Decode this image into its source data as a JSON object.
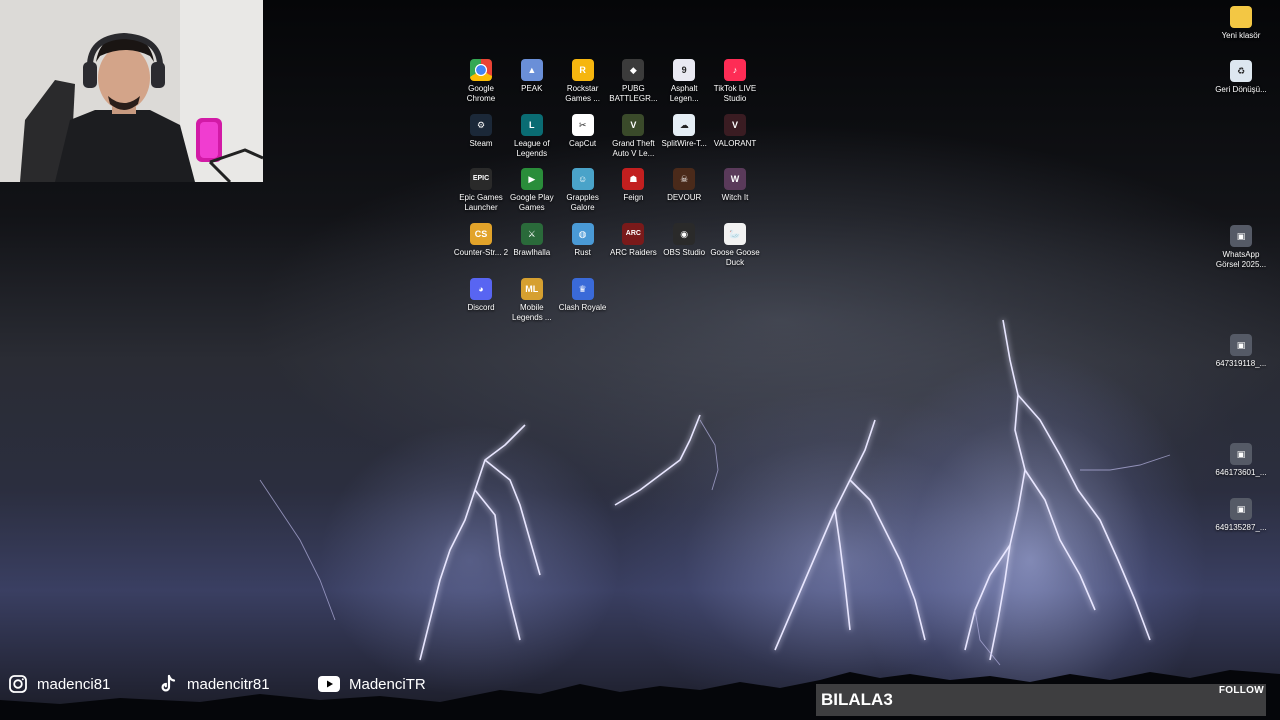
{
  "desktop_icons": [
    {
      "label": "Google Chrome",
      "icon": "chrome-icon"
    },
    {
      "label": "PEAK",
      "icon": "peak-icon"
    },
    {
      "label": "Rockstar Games ...",
      "icon": "rockstar-icon"
    },
    {
      "label": "PUBG BATTLEGR...",
      "icon": "pubg-icon"
    },
    {
      "label": "Asphalt Legen...",
      "icon": "asphalt-icon"
    },
    {
      "label": "TikTok LIVE Studio",
      "icon": "tiktok-live-icon"
    },
    {
      "label": "Steam",
      "icon": "steam-icon"
    },
    {
      "label": "League of Legends",
      "icon": "league-icon"
    },
    {
      "label": "CapCut",
      "icon": "capcut-icon"
    },
    {
      "label": "Grand Theft Auto V Le...",
      "icon": "gta-icon"
    },
    {
      "label": "SplitWire-T...",
      "icon": "splitwire-icon"
    },
    {
      "label": "VALORANT",
      "icon": "valorant-icon"
    },
    {
      "label": "Epic Games Launcher",
      "icon": "epic-icon"
    },
    {
      "label": "Google Play Games",
      "icon": "google-play-icon"
    },
    {
      "label": "Grapples Galore",
      "icon": "grapples-icon"
    },
    {
      "label": "Feign",
      "icon": "feign-icon"
    },
    {
      "label": "DEVOUR",
      "icon": "devour-icon"
    },
    {
      "label": "Witch It",
      "icon": "witch-it-icon"
    },
    {
      "label": "Counter-Str... 2",
      "icon": "counter-strike-icon"
    },
    {
      "label": "Brawlhalla",
      "icon": "brawlhalla-icon"
    },
    {
      "label": "Rust",
      "icon": "rust-icon"
    },
    {
      "label": "ARC Raiders",
      "icon": "arc-raiders-icon"
    },
    {
      "label": "OBS Studio",
      "icon": "obs-icon"
    },
    {
      "label": "Goose Goose Duck",
      "icon": "goose-icon"
    },
    {
      "label": "Discord",
      "icon": "discord-icon"
    },
    {
      "label": "Mobile Legends ...",
      "icon": "mobile-legends-icon"
    },
    {
      "label": "Clash Royale",
      "icon": "clash-royale-icon"
    }
  ],
  "right_icons": [
    {
      "label": "Yeni klasör",
      "icon": "folder-icon"
    },
    {
      "label": "Geri Dönüşü...",
      "icon": "recycle-bin-icon"
    },
    {
      "label": "WhatsApp Görsel 2025...",
      "icon": "image-file-icon"
    },
    {
      "label": "647319118_...",
      "icon": "image-file-icon"
    },
    {
      "label": "646173601_...",
      "icon": "image-file-icon"
    },
    {
      "label": "649135287_...",
      "icon": "image-file-icon"
    }
  ],
  "social": {
    "instagram": "madenci81",
    "tiktok": "madencitr81",
    "youtube": "MadenciTR"
  },
  "follow": {
    "name": "BILALA3",
    "label": "FOLLOW"
  }
}
